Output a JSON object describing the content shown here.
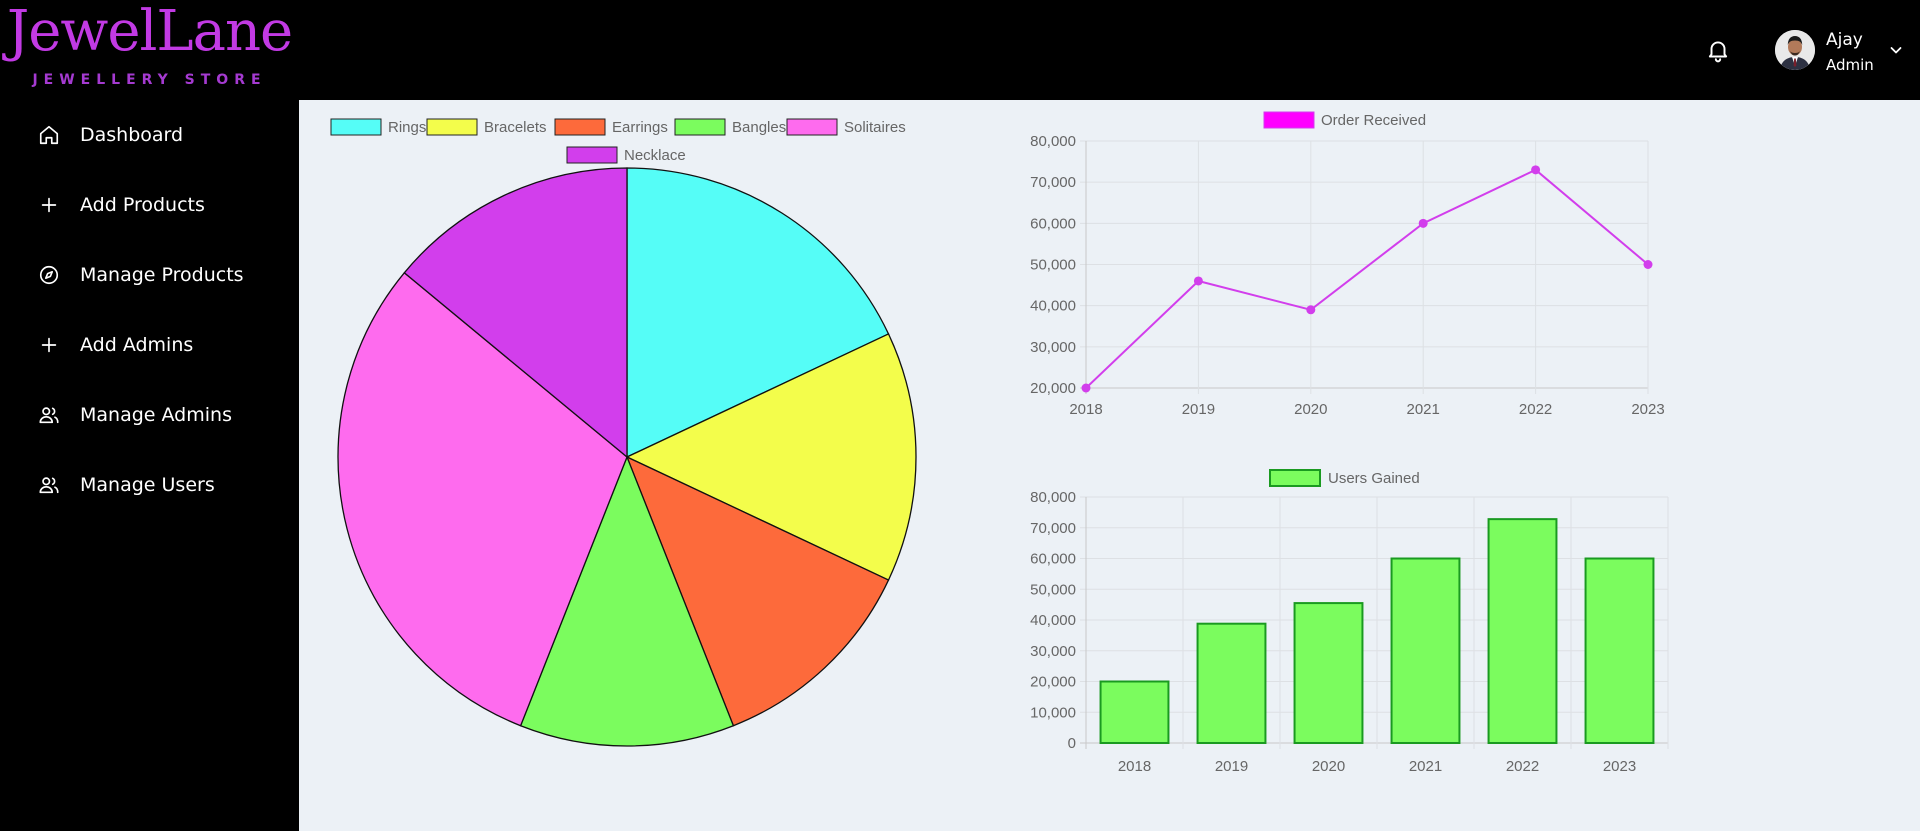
{
  "brand": {
    "title": "JewelLane",
    "subtitle": "JEWELLERY STORE",
    "color": "#c23ae4"
  },
  "sidebar": {
    "items": [
      {
        "label": "Dashboard",
        "icon": "home-icon"
      },
      {
        "label": "Add Products",
        "icon": "plus-icon"
      },
      {
        "label": "Manage Products",
        "icon": "compass-icon"
      },
      {
        "label": "Add Admins",
        "icon": "plus-icon"
      },
      {
        "label": "Manage Admins",
        "icon": "users-icon"
      },
      {
        "label": "Manage Users",
        "icon": "users-icon"
      }
    ]
  },
  "header": {
    "notification_icon": "bell-icon",
    "user": {
      "name": "Ajay",
      "role": "Admin",
      "avatar_icon": "avatar-photo",
      "menu_icon": "chevron-down-icon"
    }
  },
  "chart_data": [
    {
      "type": "pie",
      "legend_position": "top",
      "categories": [
        "Rings",
        "Bracelets",
        "Earrings",
        "Bangles",
        "Solitaires",
        "Necklace"
      ],
      "values": [
        18,
        14,
        12,
        12,
        30,
        14
      ],
      "colors": [
        "#55fdf7",
        "#f3fd4b",
        "#fd6a3b",
        "#7bfc5e",
        "#fe6bee",
        "#d23eec"
      ]
    },
    {
      "type": "line",
      "legend_position": "top",
      "x": [
        "2018",
        "2019",
        "2020",
        "2021",
        "2022",
        "2023"
      ],
      "series": [
        {
          "name": "Order Received",
          "values": [
            20000,
            46000,
            39000,
            60000,
            73000,
            50000
          ],
          "color": "#d23eec",
          "legend_color": "#ff00ff"
        }
      ],
      "ylim": [
        20000,
        80000
      ],
      "yticks": [
        "20,000",
        "30,000",
        "40,000",
        "50,000",
        "60,000",
        "70,000",
        "80,000"
      ],
      "grid": true
    },
    {
      "type": "bar",
      "legend_position": "top",
      "categories": [
        "2018",
        "2019",
        "2020",
        "2021",
        "2022",
        "2023"
      ],
      "series": [
        {
          "name": "Users Gained",
          "values": [
            20000,
            38800,
            45500,
            60000,
            72800,
            60000
          ],
          "color": "#7bfc5e",
          "border": "#1a9a20"
        }
      ],
      "ylim": [
        0,
        80000
      ],
      "yticks": [
        "0",
        "10,000",
        "20,000",
        "30,000",
        "40,000",
        "50,000",
        "60,000",
        "70,000",
        "80,000"
      ],
      "grid": true
    }
  ]
}
